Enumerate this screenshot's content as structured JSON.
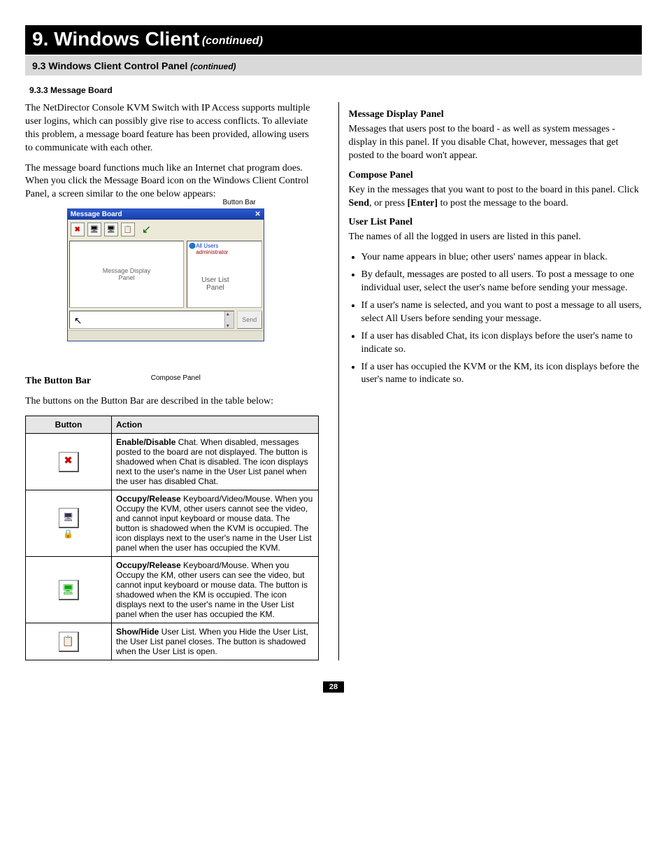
{
  "chapter": {
    "title": "9. Windows Client",
    "continued": "(continued)"
  },
  "section": {
    "title": "9.3 Windows Client Control Panel",
    "continued": "(continued)"
  },
  "subsection": "9.3.3 Message Board",
  "left": {
    "p1": "The NetDirector Console KVM Switch with IP Access supports multiple user logins, which can possibly give rise to access conflicts. To alleviate this problem, a message board feature has been provided, allowing users to communicate with each other.",
    "p2": "The message board functions much like an Internet chat program does. When you click the Message Board icon on the Windows Client Control Panel, a screen similar to the one below appears:",
    "mock": {
      "button_bar_label": "Button Bar",
      "title": "Message Board",
      "close": "✕",
      "msg_panel_label": "Message Display\nPanel",
      "all_users": "All Users",
      "admin": "administrator",
      "user_list_label": "User List\nPanel",
      "send": "Send",
      "compose_label": "Compose Panel"
    },
    "button_bar_heading": "The Button Bar",
    "button_bar_intro": "The buttons on the Button Bar are described in the table below:",
    "table": {
      "headers": {
        "button": "Button",
        "action": "Action"
      },
      "rows": [
        {
          "icon": "chat",
          "action_bold": "Enable/Disable",
          "action_rest": " Chat. When disabled, messages posted to the board are not displayed. The button is shadowed when Chat is disabled. The icon displays next to the user's name in the User List panel when the user has disabled Chat."
        },
        {
          "icon": "kvm",
          "action_bold": "Occupy/Release",
          "action_rest": " Keyboard/Video/Mouse. When you Occupy the KVM, other users cannot see the video, and cannot input keyboard or mouse data. The button is shadowed when the KVM is occupied. The icon displays next to the user's name in the User List panel when the user has occupied the KVM."
        },
        {
          "icon": "km",
          "action_bold": "Occupy/Release",
          "action_rest": " Keyboard/Mouse. When you Occupy the KM, other users can see the video, but cannot input keyboard or mouse data. The button is shadowed when the KM is occupied. The icon displays next to the user's name in the User List panel when the user has occupied the KM."
        },
        {
          "icon": "list",
          "action_bold": "Show/Hide",
          "action_rest": " User List. When you Hide the User List, the User List panel closes. The button is shadowed when the User List is open."
        }
      ]
    }
  },
  "right": {
    "mdp_h": "Message Display Panel",
    "mdp_p": "Messages that users post to the board - as well as system messages - display in this panel. If you disable Chat, however, messages that get posted to the board won't appear.",
    "cp_h": "Compose Panel",
    "cp_p1": "Key in the messages that you want to post to the board in this panel. Click ",
    "cp_send": "Send",
    "cp_p2": ", or press ",
    "cp_enter": "[Enter]",
    "cp_p3": " to post the message to the board.",
    "ulp_h": "User List Panel",
    "ulp_p": "The names of all the logged in users are listed in this panel.",
    "bullets": [
      "Your name appears in blue; other users' names appear in black.",
      "By default, messages are posted to all users. To post a message to one individual user, select the user's name before sending your message.",
      "If a user's name is selected, and you want to post a message to all users, select All Users before sending your message.",
      "If a user has disabled Chat, its icon displays before the user's name to indicate so.",
      "If a user has occupied the KVM or the KM, its icon displays before the user's name to indicate so."
    ]
  },
  "page_number": "28"
}
